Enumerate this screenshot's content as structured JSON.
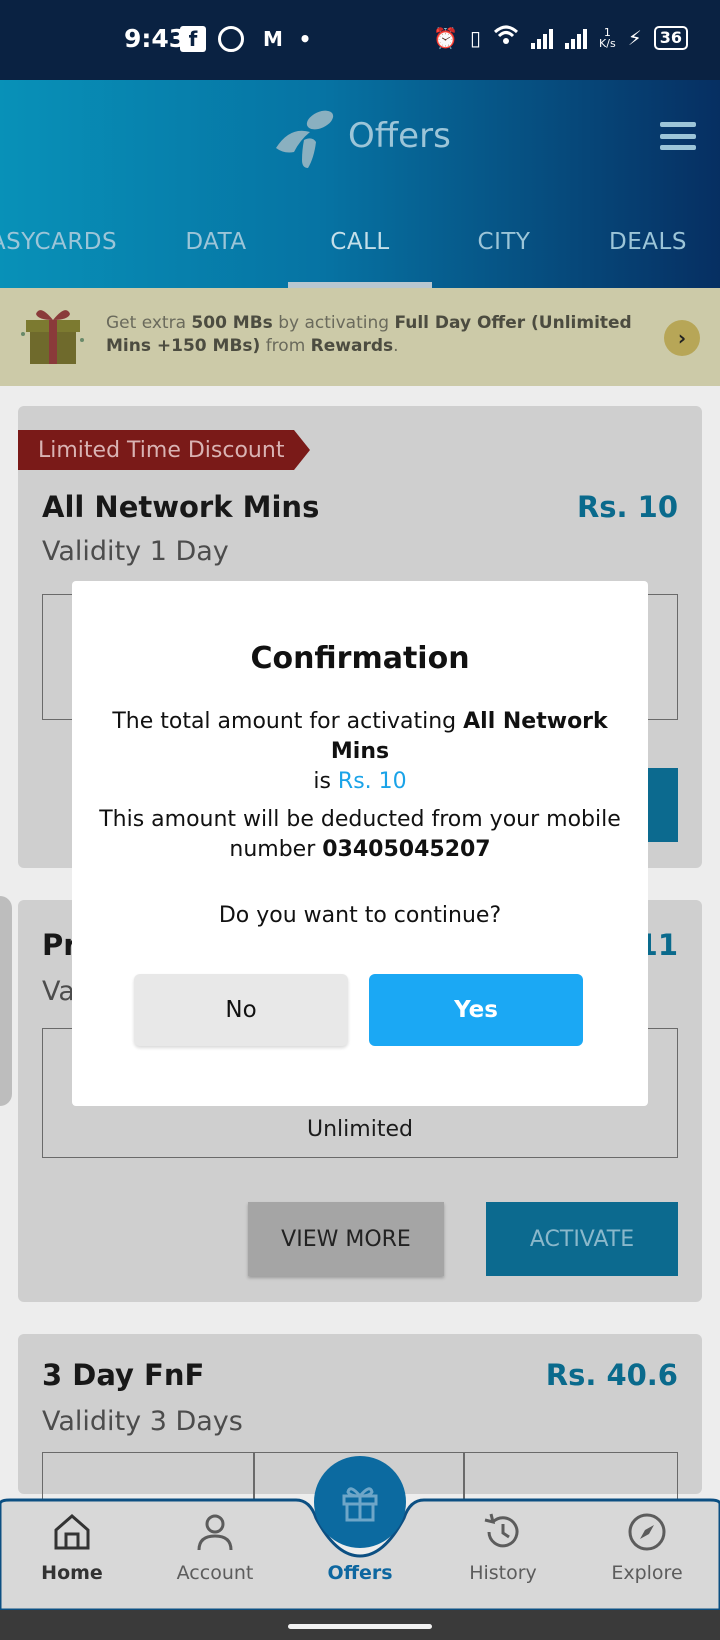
{
  "status_bar": {
    "time": "9:43",
    "speed_top": "1",
    "speed_unit": "K/s",
    "battery": "36"
  },
  "header": {
    "title": "Offers",
    "tabs": [
      "EASYCARDS",
      "DATA",
      "CALL",
      "CITY",
      "DEALS"
    ],
    "active_tab": "CALL"
  },
  "banner": {
    "prefix": "Get extra ",
    "amount": "500 MBs",
    "middle": " by activating ",
    "offer": "Full Day Offer (Unlimited Mins +150 MBs)",
    "from": " from ",
    "source": "Rewards",
    "suffix": "."
  },
  "cards": [
    {
      "ribbon": "Limited Time Discount",
      "title": "All Network Mins",
      "price": "Rs. 10",
      "validity": "Validity 1 Day"
    },
    {
      "title_visible": "Pr",
      "price_visible": "11",
      "validity_visible": "Va",
      "detail": "Unlimited",
      "view_more": "VIEW MORE",
      "activate": "ACTIVATE"
    },
    {
      "title": "3 Day FnF",
      "price": "Rs. 40.6",
      "validity": "Validity 3 Days"
    }
  ],
  "dialog": {
    "title": "Confirmation",
    "line1_prefix": "The total amount for activating ",
    "line1_offer": "All Network Mins",
    "line1_is": "is ",
    "line1_price": "Rs. 10",
    "line2_prefix": "This amount will be deducted from your mobile",
    "line2_number_prefix": "number ",
    "line2_number": "03405045207",
    "line3": "Do you want to continue?",
    "no": "No",
    "yes": "Yes"
  },
  "bottom_nav": {
    "items": [
      "Home",
      "Account",
      "Offers",
      "History",
      "Explore"
    ],
    "active": "Offers"
  },
  "colors": {
    "header_start": "#0891b8",
    "header_end": "#062f62",
    "accent_blue": "#1ba8f4",
    "price_blue": "#0a6a8c",
    "ribbon_red": "#7a1a18"
  }
}
